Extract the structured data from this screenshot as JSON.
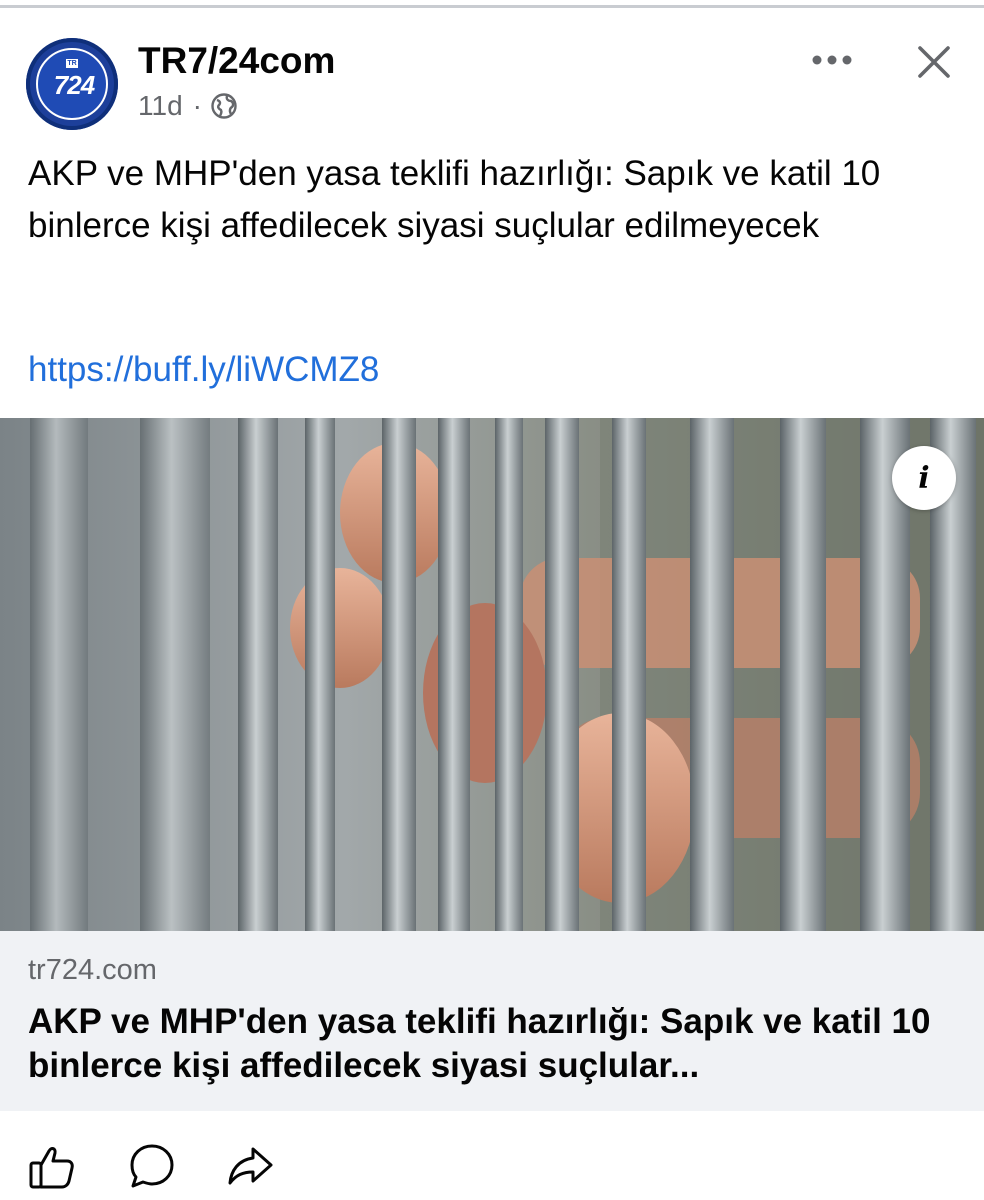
{
  "post": {
    "page_name": "TR7/24com",
    "avatar_text": "724",
    "avatar_badge": "TR",
    "time": "11d",
    "separator": "·",
    "audience_icon": "globe-icon",
    "more_icon": "more-icon",
    "close_icon": "close-icon",
    "text": "AKP ve MHP'den yasa teklifi hazırlığı: Sapık ve katil 10 binlerce kişi affedilecek siyasi suçlular edilmeyecek",
    "link_text": "https://buff.ly/liWCMZ8"
  },
  "preview": {
    "info_label": "i",
    "domain": "tr724.com",
    "title": "AKP ve MHP'den yasa teklifi hazırlığı: Sapık ve katil 10 binlerce kişi affedilecek siyasi suçlular..."
  },
  "actions": {
    "like_icon": "thumbs-up-icon",
    "comment_icon": "comment-icon",
    "share_icon": "share-icon"
  },
  "colors": {
    "link": "#216fdb",
    "muted": "#65676b",
    "card_bg": "#f0f2f5",
    "brand": "#1f4bb5"
  }
}
